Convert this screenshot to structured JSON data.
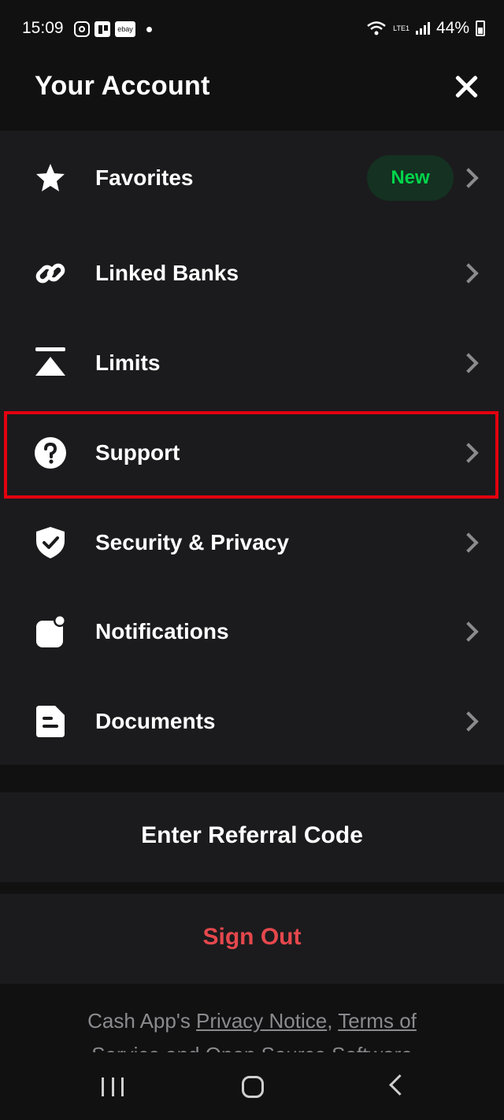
{
  "status_bar": {
    "time": "15:09",
    "battery": "44%",
    "network": "LTE1",
    "icons": [
      "instagram-icon",
      "trello-icon",
      "ebay-icon",
      "wifi-icon",
      "signal-icon",
      "battery-icon"
    ],
    "ebay_label": "ebay"
  },
  "header": {
    "title": "Your Account"
  },
  "menu": {
    "items": [
      {
        "label": "Favorites",
        "icon": "star-icon",
        "badge": "New"
      },
      {
        "label": "Linked Banks",
        "icon": "link-icon"
      },
      {
        "label": "Limits",
        "icon": "limits-icon"
      },
      {
        "label": "Support",
        "icon": "question-icon"
      },
      {
        "label": "Security & Privacy",
        "icon": "shield-check-icon"
      },
      {
        "label": "Notifications",
        "icon": "notification-icon"
      },
      {
        "label": "Documents",
        "icon": "document-icon"
      }
    ]
  },
  "actions": {
    "referral": "Enter Referral Code",
    "sign_out": "Sign Out"
  },
  "footer": {
    "prefix": "Cash App's ",
    "privacy_link": "Privacy Notice",
    "separator": ", ",
    "terms_link": "Terms of",
    "cut_line": "Service and Open Source Software"
  },
  "colors": {
    "accent_green": "#00d54b",
    "danger": "#e5484d",
    "highlight": "#e3000f",
    "background": "#111112",
    "surface": "#1b1b1d"
  }
}
